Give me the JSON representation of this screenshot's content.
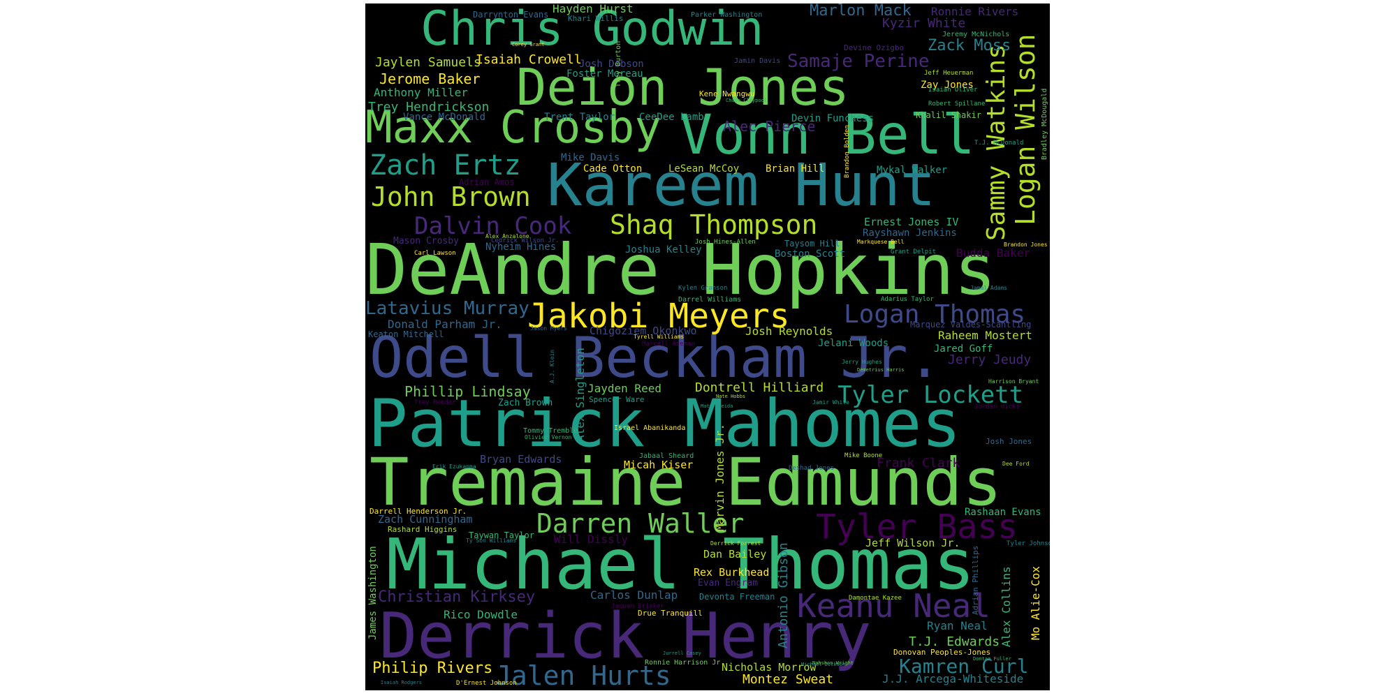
{
  "palette": {
    "background": "#000000",
    "colors": [
      "#440154",
      "#482878",
      "#3e4a89",
      "#31688e",
      "#26828e",
      "#1f9e89",
      "#35b779",
      "#6ece58",
      "#b5de2b",
      "#fde725"
    ]
  },
  "words": [
    {
      "text": "Chris Godwin",
      "color": "#35b779"
    },
    {
      "text": "Deion Jones",
      "color": "#6ece58"
    },
    {
      "text": "Maxx Crosby",
      "color": "#6ece58"
    },
    {
      "text": "Vonn Bell",
      "color": "#35b779"
    },
    {
      "text": "Kareem Hunt",
      "color": "#26828e"
    },
    {
      "text": "Zach Ertz",
      "color": "#1f9e89"
    },
    {
      "text": "John Brown",
      "color": "#b5de2b"
    },
    {
      "text": "Dalvin Cook",
      "color": "#482878"
    },
    {
      "text": "Shaq Thompson",
      "color": "#b5de2b"
    },
    {
      "text": "DeAndre Hopkins",
      "color": "#6ece58"
    },
    {
      "text": "Latavius Murray",
      "color": "#31688e"
    },
    {
      "text": "Jakobi Meyers",
      "color": "#fde725"
    },
    {
      "text": "Logan Thomas",
      "color": "#3e4a89"
    },
    {
      "text": "Odell Beckham Jr.",
      "color": "#3e4a89"
    },
    {
      "text": "Patrick Mahomes",
      "color": "#1f9e89"
    },
    {
      "text": "Tremaine Edmunds",
      "color": "#6ece58"
    },
    {
      "text": "Darren Waller",
      "color": "#6ece58"
    },
    {
      "text": "Tyler Bass",
      "color": "#440154"
    },
    {
      "text": "Michael Thomas",
      "color": "#35b779"
    },
    {
      "text": "Keanu Neal",
      "color": "#482878"
    },
    {
      "text": "Derrick Henry",
      "color": "#482878"
    },
    {
      "text": "Jalen Hurts",
      "color": "#31688e"
    },
    {
      "text": "Kamren Curl",
      "color": "#26828e"
    },
    {
      "text": "Sammy Watkins",
      "color": "#b5de2b"
    },
    {
      "text": "Logan Wilson",
      "color": "#b5de2b"
    },
    {
      "text": "Tyler Lockett",
      "color": "#1f9e89"
    },
    {
      "text": "Christian Kirksey",
      "color": "#482878"
    },
    {
      "text": "Philip Rivers",
      "color": "#fde725"
    },
    {
      "text": "Samaje Perine",
      "color": "#482878"
    },
    {
      "text": "Marlon Mack",
      "color": "#31688e"
    },
    {
      "text": "Zack Moss",
      "color": "#26828e"
    },
    {
      "text": "Kyzir White",
      "color": "#482878"
    },
    {
      "text": "Ronnie Rivers",
      "color": "#482878"
    },
    {
      "text": "Hayden Hurst",
      "color": "#6ece58"
    },
    {
      "text": "Darrynton Evans",
      "color": "#31688e"
    },
    {
      "text": "Khari Willis",
      "color": "#26828e"
    },
    {
      "text": "Parker Washington",
      "color": "#26828e"
    },
    {
      "text": "Jaylen Samuels",
      "color": "#b5de2b"
    },
    {
      "text": "Isaiah Crowell",
      "color": "#fde725"
    },
    {
      "text": "Jerome Baker",
      "color": "#fde725"
    },
    {
      "text": "Anthony Miller",
      "color": "#35b779"
    },
    {
      "text": "Trey Hendrickson",
      "color": "#35b779"
    },
    {
      "text": "Vance McDonald",
      "color": "#31688e"
    },
    {
      "text": "Trent Taylor",
      "color": "#26828e"
    },
    {
      "text": "CeeDee Lamb",
      "color": "#1f9e89"
    },
    {
      "text": "Alec Pierce",
      "color": "#482878"
    },
    {
      "text": "Devin Funchess",
      "color": "#1f9e89"
    },
    {
      "text": "Khalil Shakir",
      "color": "#6ece58"
    },
    {
      "text": "Josh Dobson",
      "color": "#3e4a89"
    },
    {
      "text": "Foster Moreau",
      "color": "#1f9e89"
    },
    {
      "text": "Jamin Davis",
      "color": "#3e4a89"
    },
    {
      "text": "Devine Ozigbo",
      "color": "#482878"
    },
    {
      "text": "Zay Jones",
      "color": "#fde725"
    },
    {
      "text": "Mike Davis",
      "color": "#31688e"
    },
    {
      "text": "Cade Otton",
      "color": "#fde725"
    },
    {
      "text": "LeSean McCoy",
      "color": "#b5de2b"
    },
    {
      "text": "Brian Hill",
      "color": "#fde725"
    },
    {
      "text": "Mykal Walker",
      "color": "#1f9e89"
    },
    {
      "text": "Adrian Amos",
      "color": "#440154"
    },
    {
      "text": "Ernest Jones IV",
      "color": "#35b779"
    },
    {
      "text": "Rayshawn Jenkins",
      "color": "#31688e"
    },
    {
      "text": "Mason Crosby",
      "color": "#482878"
    },
    {
      "text": "Nyheim Hines",
      "color": "#31688e"
    },
    {
      "text": "Joshua Kelley",
      "color": "#26828e"
    },
    {
      "text": "Taysom Hill",
      "color": "#26828e"
    },
    {
      "text": "Boston Scott",
      "color": "#26828e"
    },
    {
      "text": "Budda Baker",
      "color": "#440154"
    },
    {
      "text": "Donald Parham Jr.",
      "color": "#31688e"
    },
    {
      "text": "Keaton Mitchell",
      "color": "#31688e"
    },
    {
      "text": "Chigoziem Okonkwo",
      "color": "#3e4a89"
    },
    {
      "text": "Josh Reynolds",
      "color": "#b5de2b"
    },
    {
      "text": "Jelani Woods",
      "color": "#1f9e89"
    },
    {
      "text": "Raheem Mostert",
      "color": "#b5de2b"
    },
    {
      "text": "Jared Goff",
      "color": "#35b779"
    },
    {
      "text": "Jerry Jeudy",
      "color": "#482878"
    },
    {
      "text": "Marquez Valdes-Scantling",
      "color": "#3e4a89"
    },
    {
      "text": "Phillip Lindsay",
      "color": "#6ece58"
    },
    {
      "text": "Jayden Reed",
      "color": "#6ece58"
    },
    {
      "text": "Dontrell Hilliard",
      "color": "#b5de2b"
    },
    {
      "text": "Zach Brown",
      "color": "#1f9e89"
    },
    {
      "text": "Spencer Ware",
      "color": "#1f9e89"
    },
    {
      "text": "Alex Singleton",
      "color": "#1f9e89"
    },
    {
      "text": "Bryan Edwards",
      "color": "#3e4a89"
    },
    {
      "text": "Micah Kiser",
      "color": "#fde725"
    },
    {
      "text": "Marvin Jones Jr.",
      "color": "#b5de2b"
    },
    {
      "text": "Frank Clark",
      "color": "#440154"
    },
    {
      "text": "Zach Cunningham",
      "color": "#31688e"
    },
    {
      "text": "Darrell Henderson Jr.",
      "color": "#fde725"
    },
    {
      "text": "Rashard Higgins",
      "color": "#b5de2b"
    },
    {
      "text": "Taywan Taylor",
      "color": "#35b779"
    },
    {
      "text": "Will Dissly",
      "color": "#440154"
    },
    {
      "text": "Rashaan Evans",
      "color": "#35b779"
    },
    {
      "text": "Jeff Wilson Jr.",
      "color": "#b5de2b"
    },
    {
      "text": "Dan Bailey",
      "color": "#b5de2b"
    },
    {
      "text": "Rex Burkhead",
      "color": "#fde725"
    },
    {
      "text": "Evan Engram",
      "color": "#482878"
    },
    {
      "text": "Antonio Gibson",
      "color": "#26828e"
    },
    {
      "text": "Carlos Dunlap",
      "color": "#31688e"
    },
    {
      "text": "Devonta Freeman",
      "color": "#26828e"
    },
    {
      "text": "Rico Dowdle",
      "color": "#35b779"
    },
    {
      "text": "James Washington",
      "color": "#6ece58"
    },
    {
      "text": "Drue Tranquill",
      "color": "#fde725"
    },
    {
      "text": "Ryan Neal",
      "color": "#26828e"
    },
    {
      "text": "T.J. Edwards",
      "color": "#6ece58"
    },
    {
      "text": "Alex Collins",
      "color": "#35b779"
    },
    {
      "text": "Mo Alie-Cox",
      "color": "#fde725"
    },
    {
      "text": "Nicholas Morrow",
      "color": "#b5de2b"
    },
    {
      "text": "Montez Sweat",
      "color": "#fde725"
    },
    {
      "text": "J.J. Arcega-Whiteside",
      "color": "#26828e"
    },
    {
      "text": "Ronnie Harrison Jr.",
      "color": "#6ece58"
    },
    {
      "text": "Donovan Peoples-Jones",
      "color": "#fde725"
    },
    {
      "text": "Adrian Phillips",
      "color": "#31688e"
    },
    {
      "text": "Josh Jones",
      "color": "#31688e"
    },
    {
      "text": "Tyler Johnson",
      "color": "#26828e"
    },
    {
      "text": "Israel Abanikanda",
      "color": "#fde725"
    },
    {
      "text": "Tommy Tremble",
      "color": "#35b779"
    },
    {
      "text": "Jabaal Sheard",
      "color": "#35b779"
    },
    {
      "text": "Jaquan Brisker",
      "color": "#440154"
    },
    {
      "text": "Jeremy McNichols",
      "color": "#35b779"
    },
    {
      "text": "Kene Nwangwu",
      "color": "#fde725"
    },
    {
      "text": "Jeff Heuerman",
      "color": "#b5de2b"
    },
    {
      "text": "Isaiah Oliver",
      "color": "#35b779"
    },
    {
      "text": "Robert Spillane",
      "color": "#35b779"
    },
    {
      "text": "T.J. McDonald",
      "color": "#1f9e89"
    },
    {
      "text": "Bradley McDougald",
      "color": "#6ece58"
    },
    {
      "text": "Brandon Bolden",
      "color": "#fde725"
    },
    {
      "text": "Cedrick Wilson Jr.",
      "color": "#3e4a89"
    },
    {
      "text": "Josh Hines-Allen",
      "color": "#6ece58"
    },
    {
      "text": "Markquese Bell",
      "color": "#fde725"
    },
    {
      "text": "Brandon Jones",
      "color": "#fde725"
    },
    {
      "text": "Alex Anzalone",
      "color": "#b5de2b"
    },
    {
      "text": "Carl Lawson",
      "color": "#fde725"
    },
    {
      "text": "Grant Delpit",
      "color": "#1f9e89"
    },
    {
      "text": "Jamal Adams",
      "color": "#26828e"
    },
    {
      "text": "Kylen Granson",
      "color": "#26828e"
    },
    {
      "text": "Darrel Williams",
      "color": "#35b779"
    },
    {
      "text": "Adarius Taylor",
      "color": "#35b779"
    },
    {
      "text": "Jason Myers",
      "color": "#31688e"
    },
    {
      "text": "Tyrell Williams",
      "color": "#fde725"
    },
    {
      "text": "Marcell Ateman",
      "color": "#440154"
    },
    {
      "text": "Jerry Hughes",
      "color": "#1f9e89"
    },
    {
      "text": "Demetrius Harris",
      "color": "#6ece58"
    },
    {
      "text": "Harrison Bryant",
      "color": "#6ece58"
    },
    {
      "text": "Jordan Hicks",
      "color": "#440154"
    },
    {
      "text": "Trey Reeder",
      "color": "#440154"
    },
    {
      "text": "Nate Hobbs",
      "color": "#b5de2b"
    },
    {
      "text": "Matt Breida",
      "color": "#1f9e89"
    },
    {
      "text": "Jamir White",
      "color": "#1f9e89"
    },
    {
      "text": "Olivier Vernon",
      "color": "#35b779"
    },
    {
      "text": "Mike Boone",
      "color": "#b5de2b"
    },
    {
      "text": "Deshad Jones",
      "color": "#31688e"
    },
    {
      "text": "Dee Ford",
      "color": "#b5de2b"
    },
    {
      "text": "Erik Ezukanma",
      "color": "#1f9e89"
    },
    {
      "text": "Ty'Son Williams",
      "color": "#26828e"
    },
    {
      "text": "Derrick Forrest",
      "color": "#b5de2b"
    },
    {
      "text": "Damontae Kazee",
      "color": "#b5de2b"
    },
    {
      "text": "Jurrell Casey",
      "color": "#1f9e89"
    },
    {
      "text": "Nahshon Wright",
      "color": "#6ece58"
    },
    {
      "text": "D'Ernest Johnson",
      "color": "#fde725"
    },
    {
      "text": "Isaiah Rodgers",
      "color": "#26828e"
    },
    {
      "text": "A.J. Klein",
      "color": "#26828e"
    },
    {
      "text": "Corey Grant",
      "color": "#fde725"
    },
    {
      "text": "Trey Burton",
      "color": "#6ece58"
    },
    {
      "text": "Michael Dickson",
      "color": "#1f9e89"
    },
    {
      "text": "Chase Claypool",
      "color": "#35b779"
    },
    {
      "text": "Dontae Fuller",
      "color": "#35b779"
    }
  ]
}
